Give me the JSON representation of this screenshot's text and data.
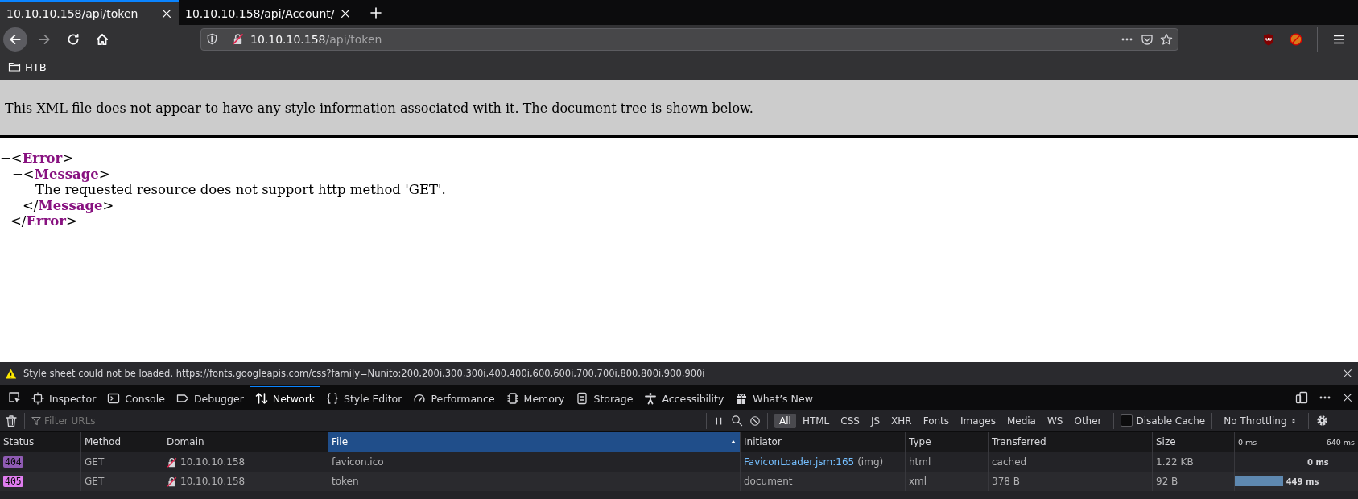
{
  "tabs": [
    {
      "title": "10.10.10.158/api/token",
      "selected": true
    },
    {
      "title": "10.10.10.158/api/Account/",
      "selected": false
    }
  ],
  "nav_buttons": [
    {
      "kind": "back",
      "disabled": false
    },
    {
      "kind": "forward",
      "disabled": true
    },
    {
      "kind": "reload",
      "disabled": false
    },
    {
      "kind": "home",
      "disabled": false
    }
  ],
  "address_bar": {
    "host": "10.10.10.158",
    "path": "/api/token"
  },
  "bookmarks": [
    {
      "label": "HTB"
    }
  ],
  "xml_notice": "This XML file does not appear to have any style information associated with it. The document tree is shown below.",
  "xml_tree": [
    {
      "toggle": "−",
      "open_tag": [
        "<",
        "Error",
        ">"
      ],
      "close_tag": [
        "</",
        "Error",
        ">"
      ],
      "children": [
        {
          "toggle": "−",
          "open_tag": [
            "<",
            "Message",
            ">"
          ],
          "close_tag": [
            "</",
            "Message",
            ">"
          ],
          "children": [
            {
              "text": "The requested resource does not support http method 'GET'."
            }
          ]
        }
      ]
    }
  ],
  "devtools": {
    "notification": "Style sheet could not be loaded. https://fonts.googleapis.com/css?family=Nunito:200,200i,300,300i,400,400i,600,600i,700,700i,800,800i,900,900i",
    "tabs": [
      {
        "label": "Inspector",
        "kind": "inspector",
        "selected": false
      },
      {
        "label": "Console",
        "kind": "console",
        "selected": false
      },
      {
        "label": "Debugger",
        "kind": "debugger",
        "selected": false
      },
      {
        "label": "Network",
        "kind": "network",
        "selected": true
      },
      {
        "label": "Style Editor",
        "kind": "style",
        "selected": false
      },
      {
        "label": "Performance",
        "kind": "performance",
        "selected": false
      },
      {
        "label": "Memory",
        "kind": "memory",
        "selected": false
      },
      {
        "label": "Storage",
        "kind": "storage",
        "selected": false
      },
      {
        "label": "Accessibility",
        "kind": "accessibility",
        "selected": false
      },
      {
        "label": "What’s New",
        "kind": "whatsnew",
        "selected": false
      }
    ],
    "filter": {
      "placeholder": "Filter URLs"
    },
    "type_filters": [
      {
        "label": "All",
        "selected": true
      },
      {
        "label": "HTML",
        "selected": false
      },
      {
        "label": "CSS",
        "selected": false
      },
      {
        "label": "JS",
        "selected": false
      },
      {
        "label": "XHR",
        "selected": false
      },
      {
        "label": "Fonts",
        "selected": false
      },
      {
        "label": "Images",
        "selected": false
      },
      {
        "label": "Media",
        "selected": false
      },
      {
        "label": "WS",
        "selected": false
      },
      {
        "label": "Other",
        "selected": false
      }
    ],
    "disable_cache": {
      "label": "Disable Cache",
      "checked": false
    },
    "throttling": "No Throttling",
    "table": {
      "columns": [
        {
          "label": "Status",
          "sorted": false
        },
        {
          "label": "Method",
          "sorted": false
        },
        {
          "label": "Domain",
          "sorted": false
        },
        {
          "label": "File",
          "sorted": true
        },
        {
          "label": "Initiator",
          "sorted": false
        },
        {
          "label": "Type",
          "sorted": false
        },
        {
          "label": "Transferred",
          "sorted": false
        },
        {
          "label": "Size",
          "sorted": false
        }
      ],
      "waterfall_ticks": [
        "0 ms",
        "640 ms"
      ],
      "rows": [
        {
          "status": "404",
          "color": "#8f5bb3",
          "method": "GET",
          "domain": "10.10.10.158",
          "file": "favicon.ico",
          "initiator_link": "FaviconLoader.jsm:165",
          "initiator": "(img)",
          "type": "html",
          "transferred": "cached",
          "size": "1.22 KB",
          "timing": "0 ms"
        },
        {
          "status": "405",
          "color": "#e07df0",
          "method": "GET",
          "domain": "10.10.10.158",
          "file": "token",
          "initiator": "document",
          "type": "xml",
          "transferred": "378 B",
          "size": "92 B",
          "level": 0.39,
          "timing": "449 ms"
        }
      ]
    }
  }
}
